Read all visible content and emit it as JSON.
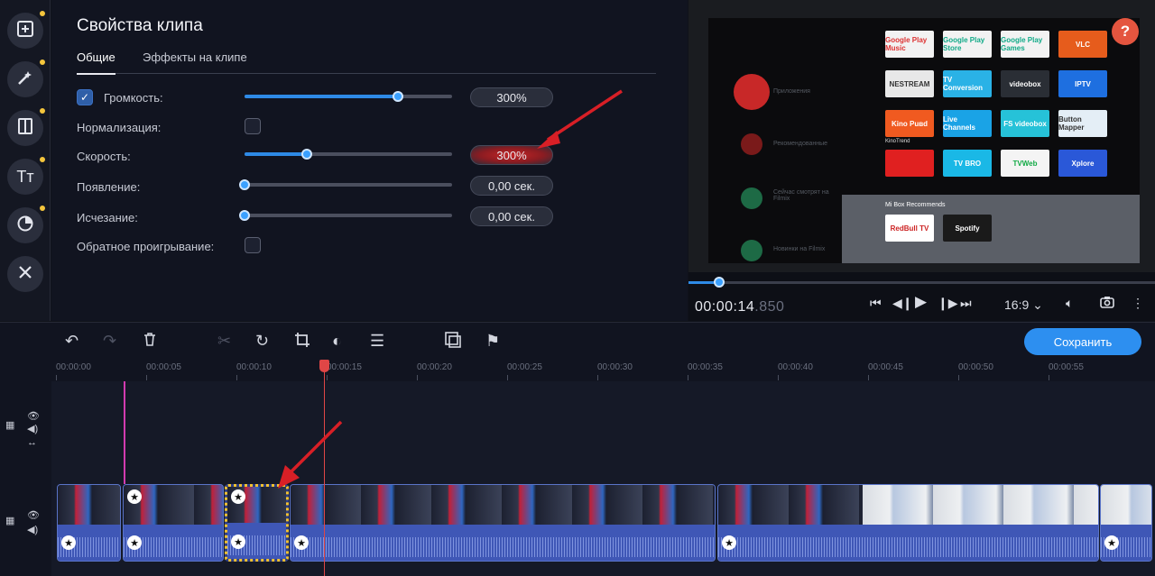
{
  "sidebar": {
    "items": [
      {
        "name": "import",
        "icon": "add-file-icon",
        "has_dot": true
      },
      {
        "name": "effects",
        "icon": "magic-wand-icon",
        "has_dot": true
      },
      {
        "name": "transitions",
        "icon": "transition-icon",
        "has_dot": true
      },
      {
        "name": "titles",
        "icon": "text-icon",
        "has_dot": true,
        "label": "Tт"
      },
      {
        "name": "stickers",
        "icon": "sticker-icon",
        "has_dot": true
      },
      {
        "name": "tools",
        "icon": "tools-icon",
        "has_dot": false
      }
    ]
  },
  "properties": {
    "title": "Свойства клипа",
    "tabs": [
      {
        "label": "Общие",
        "active": true
      },
      {
        "label": "Эффекты на клипе",
        "active": false
      }
    ],
    "rows": {
      "volume": {
        "label": "Громкость:",
        "checked": true,
        "value": "300%",
        "level": 0.74
      },
      "normalize": {
        "label": "Нормализация:",
        "checked": false
      },
      "speed": {
        "label": "Скорость:",
        "value": "300%",
        "level": 0.3
      },
      "fade_in": {
        "label": "Появление:",
        "value": "0,00 сек.",
        "level": 0
      },
      "fade_out": {
        "label": "Исчезание:",
        "value": "0,00 сек.",
        "level": 0
      },
      "reverse": {
        "label": "Обратное проигрывание:",
        "checked": false
      }
    }
  },
  "preview": {
    "help": "?",
    "timecode_main": "00:00:14",
    "timecode_ms": ".850",
    "aspect": "16:9",
    "progress": 0.065,
    "tv": {
      "menu": [
        "Приложения",
        "Рекомендованные",
        "Сейчас смотрят на Filmix",
        "Новинки на Filmix"
      ],
      "tiles": [
        {
          "label": "Google Play Music",
          "color": "#f2f2f2",
          "fg": "#d33"
        },
        {
          "label": "Google Play Store",
          "color": "#f2f2f2",
          "fg": "#1a8"
        },
        {
          "label": "Google Play Games",
          "color": "#f2f2f2",
          "fg": "#1a8"
        },
        {
          "label": "VLC",
          "color": "#e65c1c",
          "fg": "#fff"
        },
        {
          "label": "NESTREAM",
          "color": "#e8e8e8",
          "fg": "#333"
        },
        {
          "label": "TV Conversion",
          "color": "#2ab2e6",
          "fg": "#fff"
        },
        {
          "label": "videobox",
          "color": "#2a2e35",
          "fg": "#fff"
        },
        {
          "label": "IPTV",
          "color": "#1e6fe0",
          "fg": "#fff"
        },
        {
          "label": "Kino Puвd",
          "color": "#f05a20",
          "fg": "#fff"
        },
        {
          "label": "Live Channels",
          "color": "#1aa3e6",
          "fg": "#fff"
        },
        {
          "label": "FS videobox",
          "color": "#26c2d8",
          "fg": "#fff"
        },
        {
          "label": "Button Mapper",
          "color": "#e4eef6",
          "fg": "#333"
        },
        {
          "label": "",
          "color": "#e02020",
          "fg": "#fff"
        },
        {
          "label": "TV BRO",
          "color": "#1ab8e6",
          "fg": "#fff"
        },
        {
          "label": "TVWeb",
          "color": "#f4f4f4",
          "fg": "#1a4"
        },
        {
          "label": "Xplore",
          "color": "#2a58d8",
          "fg": "#fff"
        }
      ],
      "tile_caption": "KinoTrend",
      "recommends_title": "Mi Box Recommends",
      "recommends": [
        "RedBull TV",
        "Spotify"
      ]
    }
  },
  "toolbar": {
    "save_label": "Сохранить"
  },
  "timeline": {
    "ticks": [
      "00:00:00",
      "00:00:05",
      "00:00:10",
      "00:00:15",
      "00:00:20",
      "00:00:25",
      "00:00:30",
      "00:00:35",
      "00:00:40",
      "00:00:45",
      "00:00:50",
      "00:00:55"
    ]
  }
}
